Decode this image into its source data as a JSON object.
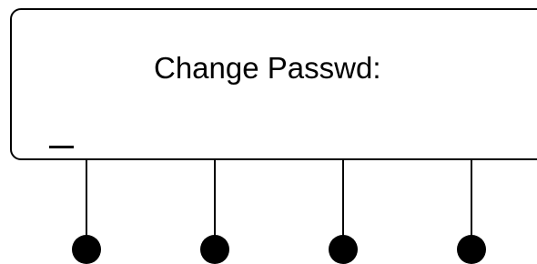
{
  "screen": {
    "title": "Change Passwd:",
    "input_cursor": "_"
  },
  "softkeys": [
    {
      "name": "softkey-1"
    },
    {
      "name": "softkey-2"
    },
    {
      "name": "softkey-3"
    },
    {
      "name": "softkey-4"
    }
  ],
  "colors": {
    "foreground": "#000000",
    "background": "#ffffff"
  }
}
